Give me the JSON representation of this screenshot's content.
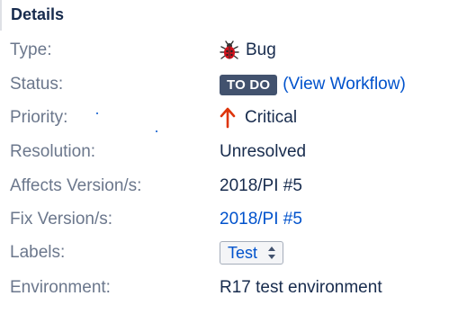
{
  "details": {
    "heading": "Details",
    "rows": {
      "type": {
        "label": "Type:",
        "value": "Bug",
        "icon": "bug-icon"
      },
      "status": {
        "label": "Status:",
        "value": "TO DO",
        "link": "(View Workflow)",
        "lozenge_color": "#42526e"
      },
      "priority": {
        "label": "Priority:",
        "value": "Critical",
        "icon": "arrow-up-icon",
        "icon_color": "#de350b"
      },
      "resolution": {
        "label": "Resolution:",
        "value": "Unresolved"
      },
      "affects_version": {
        "label": "Affects Version/s:",
        "value": "2018/PI #5"
      },
      "fix_version": {
        "label": "Fix Version/s:",
        "value": "2018/PI #5"
      },
      "labels": {
        "label": "Labels:",
        "value": "Test"
      },
      "environment": {
        "label": "Environment:",
        "value": "R17 test environment"
      }
    }
  }
}
